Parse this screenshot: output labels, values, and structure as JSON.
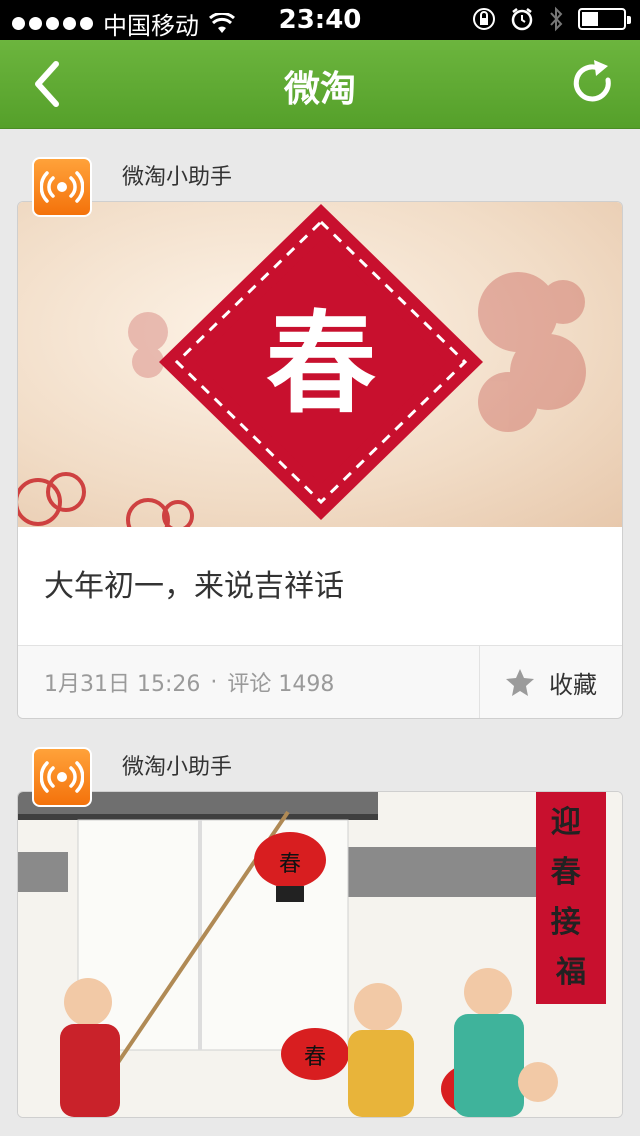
{
  "status_bar": {
    "carrier": "中国移动",
    "time": "23:40"
  },
  "nav": {
    "title": "微淘",
    "icons": {
      "back": "chevron-left-icon",
      "refresh": "refresh-icon"
    }
  },
  "colors": {
    "nav_green": "#5eaa32",
    "avatar_orange": "#f7820f",
    "chun_red": "#c8102e"
  },
  "posts": [
    {
      "author": "微淘小助手",
      "image_glyph": "春",
      "title": "大年初一，来说吉祥话",
      "date": "1月31日 15:26",
      "separator": "·",
      "comments": "评论 1498",
      "fav_label": "收藏"
    },
    {
      "author": "微淘小助手",
      "image_glyph": "春",
      "banner_text": "迎春接福"
    }
  ]
}
